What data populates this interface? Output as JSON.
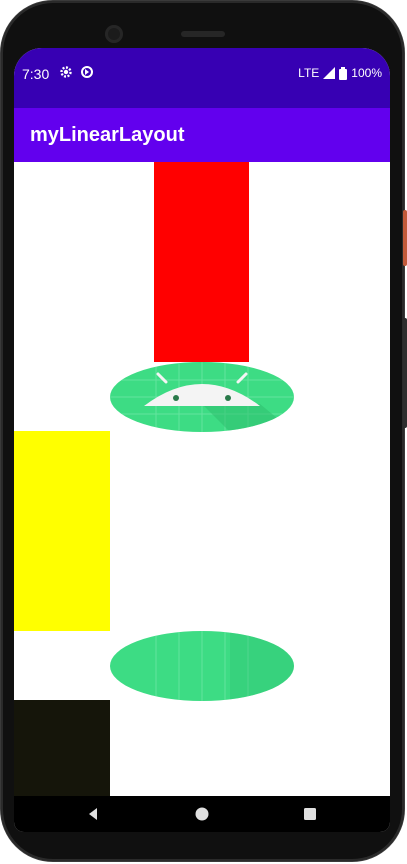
{
  "status_bar": {
    "time": "7:30",
    "network": "LTE",
    "battery": "100%",
    "icons": [
      "settings-gear-icon",
      "data-saver-icon",
      "signal-icon",
      "battery-icon"
    ],
    "background": "#3700b3"
  },
  "app_bar": {
    "title": "myLinearLayout",
    "background": "#6200ee"
  },
  "content": {
    "blocks": [
      {
        "name": "red-block",
        "color": "#ff0000"
      },
      {
        "name": "android-logo-image",
        "color": "#3ddc84"
      },
      {
        "name": "yellow-block",
        "color": "#ffff00"
      },
      {
        "name": "green-ellipse-image",
        "color": "#3ddc84"
      },
      {
        "name": "dark-block",
        "color": "#15150a"
      }
    ]
  },
  "nav_bar": {
    "buttons": [
      "back-icon",
      "home-icon",
      "recents-icon"
    ]
  }
}
